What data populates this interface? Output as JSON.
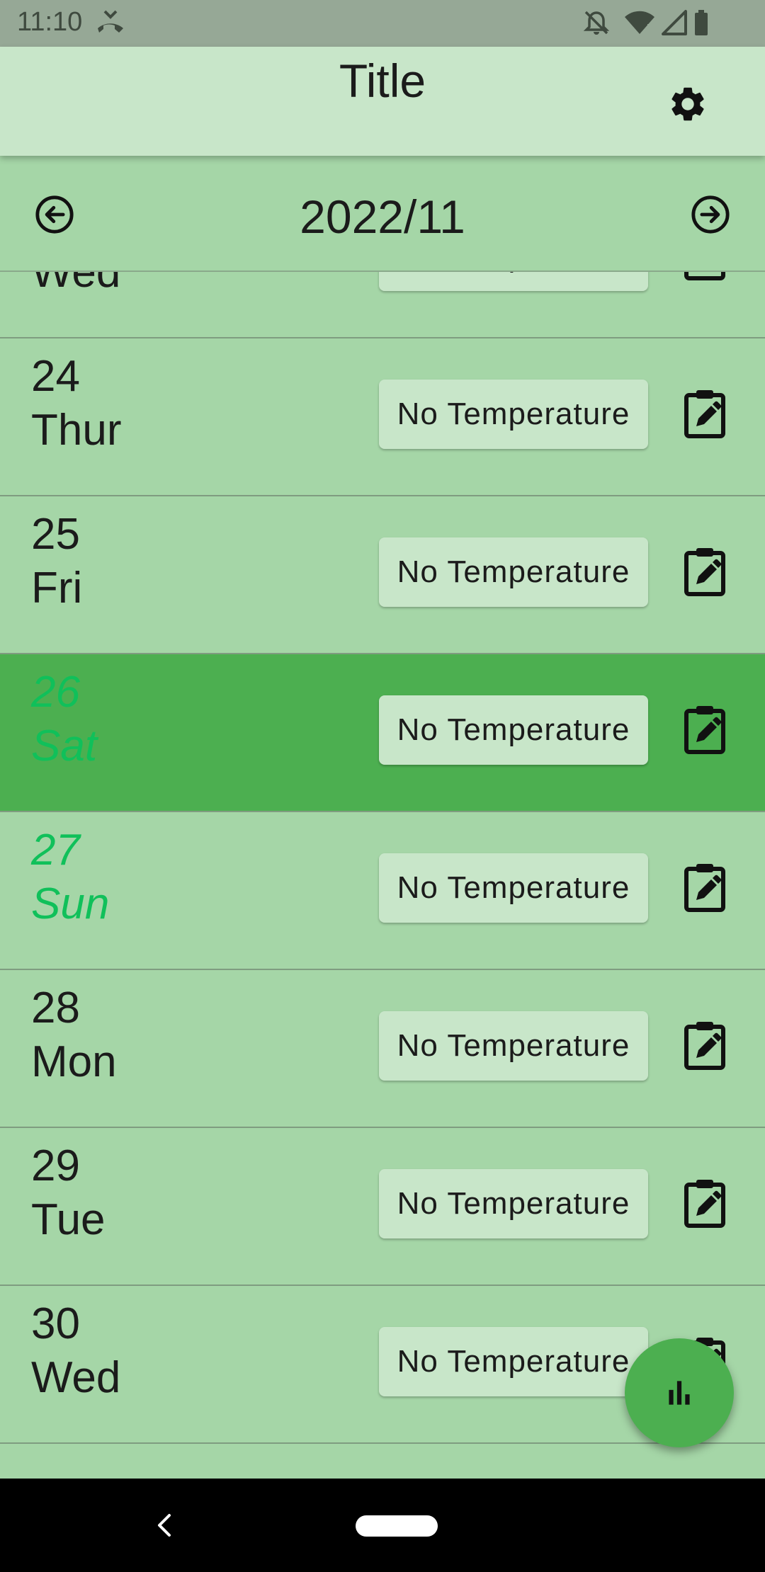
{
  "status_bar": {
    "time": "11:10",
    "icons": [
      "call-forward-icon",
      "notifications-off-icon",
      "wifi-icon",
      "signal-icon",
      "battery-icon"
    ]
  },
  "app_bar": {
    "title": "Title",
    "settings_icon": "gear-icon"
  },
  "month_nav": {
    "label": "2022/11",
    "prev_icon": "arrow-left-circle-icon",
    "next_icon": "arrow-right-circle-icon"
  },
  "days": [
    {
      "num": "",
      "name": "Wed",
      "temperature": "No Temperature",
      "weekend": false,
      "selected": false
    },
    {
      "num": "24",
      "name": "Thur",
      "temperature": "No Temperature",
      "weekend": false,
      "selected": false
    },
    {
      "num": "25",
      "name": "Fri",
      "temperature": "No Temperature",
      "weekend": false,
      "selected": false
    },
    {
      "num": "26",
      "name": "Sat",
      "temperature": "No Temperature",
      "weekend": true,
      "selected": true
    },
    {
      "num": "27",
      "name": "Sun",
      "temperature": "No Temperature",
      "weekend": true,
      "selected": false
    },
    {
      "num": "28",
      "name": "Mon",
      "temperature": "No Temperature",
      "weekend": false,
      "selected": false
    },
    {
      "num": "29",
      "name": "Tue",
      "temperature": "No Temperature",
      "weekend": false,
      "selected": false
    },
    {
      "num": "30",
      "name": "Wed",
      "temperature": "No Temperature",
      "weekend": false,
      "selected": false
    }
  ],
  "fab": {
    "icon": "bar-chart-icon"
  },
  "colors": {
    "app_bar": "#c8e6c9",
    "list_background": "#a5d6a7",
    "selected_row": "#4caf50",
    "weekend_text": "#10c05a",
    "fab": "#4caf50"
  }
}
